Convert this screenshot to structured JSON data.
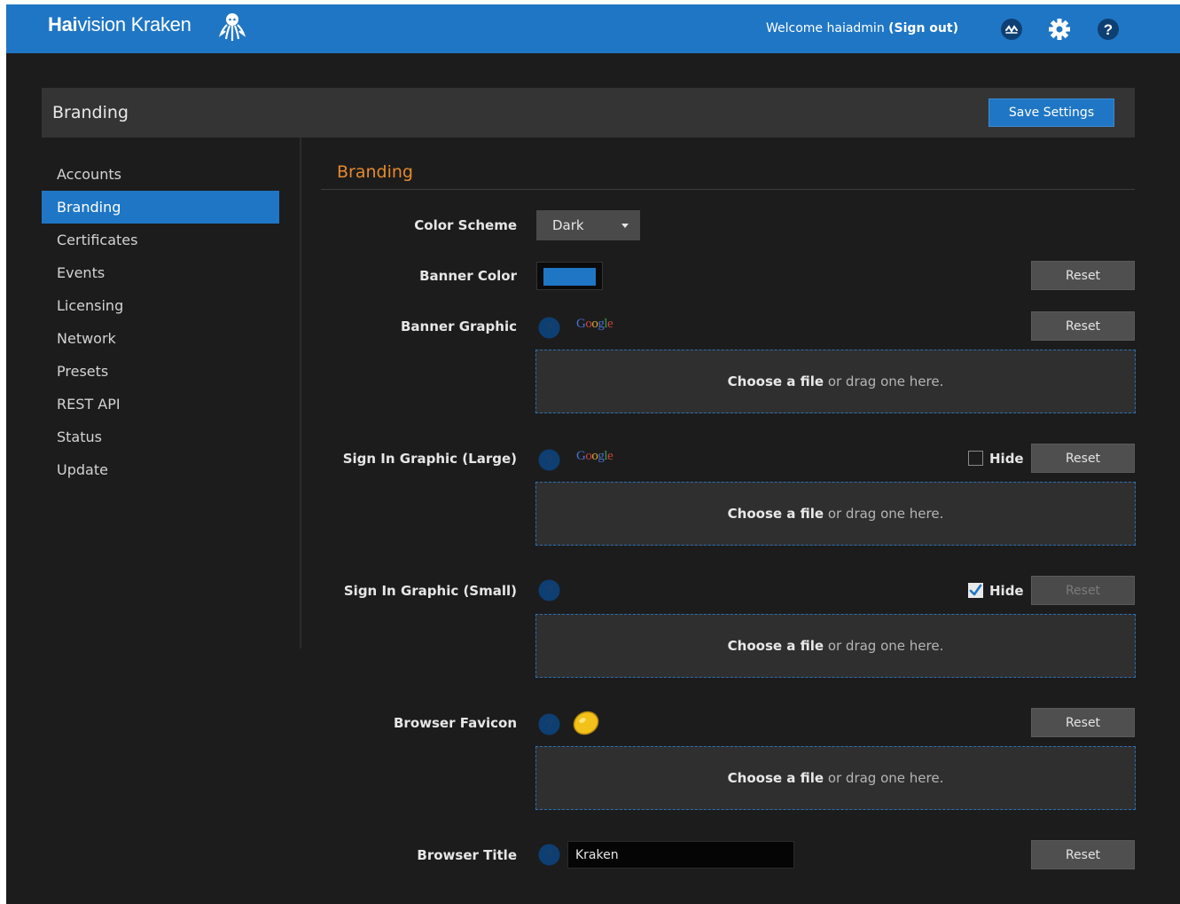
{
  "header": {
    "logo_bold": "Hai",
    "logo_rest": "vision Kraken",
    "welcome_prefix": "Welcome haiadmin ",
    "sign_out": "(Sign out)"
  },
  "page": {
    "title": "Branding",
    "save_label": "Save Settings"
  },
  "sidebar": {
    "items": [
      {
        "label": "Accounts"
      },
      {
        "label": "Branding",
        "active": true
      },
      {
        "label": "Certificates"
      },
      {
        "label": "Events"
      },
      {
        "label": "Licensing"
      },
      {
        "label": "Network"
      },
      {
        "label": "Presets"
      },
      {
        "label": "REST API"
      },
      {
        "label": "Status"
      },
      {
        "label": "Update"
      }
    ]
  },
  "section": {
    "title": "Branding"
  },
  "form": {
    "color_scheme": {
      "label": "Color Scheme",
      "value": "Dark"
    },
    "banner_color": {
      "label": "Banner Color",
      "value": "#1f76c4",
      "reset": "Reset"
    },
    "banner_graphic": {
      "label": "Banner Graphic",
      "logo": "Google",
      "reset": "Reset"
    },
    "sign_in_large": {
      "label": "Sign In Graphic (Large)",
      "logo": "Google",
      "hide_label": "Hide",
      "hide_checked": false,
      "reset": "Reset"
    },
    "sign_in_small": {
      "label": "Sign In Graphic (Small)",
      "hide_label": "Hide",
      "hide_checked": true,
      "reset": "Reset",
      "reset_disabled": true
    },
    "favicon": {
      "label": "Browser Favicon",
      "reset": "Reset"
    },
    "browser_title": {
      "label": "Browser Title",
      "value": "Kraken",
      "reset": "Reset"
    },
    "dropzone": {
      "choose": "Choose a file",
      "rest": " or drag one here."
    }
  },
  "colors": {
    "brand": "#1f76c4",
    "accent": "#e58a2d",
    "background": "#1c1c1c"
  },
  "icons": [
    "octopus-logo-icon",
    "status-icon",
    "gear-icon",
    "help-icon",
    "question-circle-icon",
    "lemon-favicon-icon",
    "checkmark-icon",
    "caret-down-icon"
  ]
}
